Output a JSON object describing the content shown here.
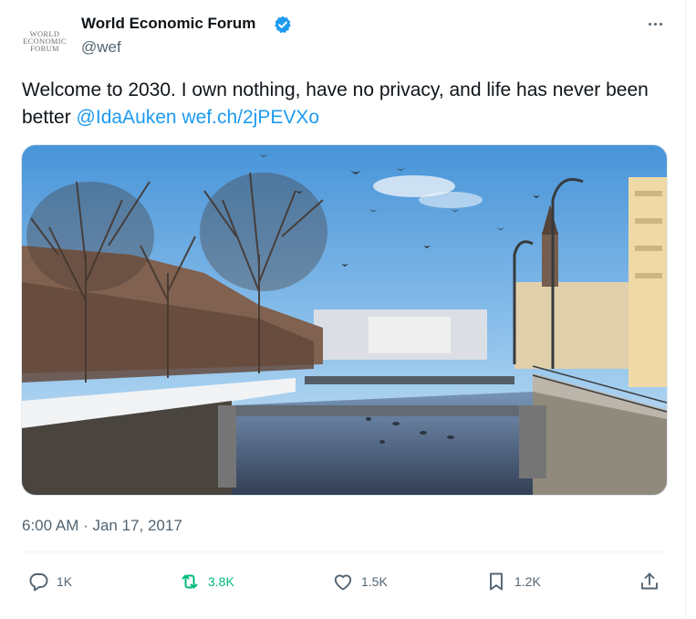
{
  "author": {
    "display_name": "World Economic Forum",
    "handle": "@wef",
    "avatar_lines": [
      "WORLD",
      "ECONOMIC",
      "FORUM"
    ],
    "verified_icon": "verified-badge-icon"
  },
  "tweet": {
    "text": "Welcome to 2030. I own nothing, have no privacy, and life has never been better",
    "mention": "@IdaAuken",
    "link": "wef.ch/2jPEVXo",
    "timestamp": "6:00 AM · Jan 17, 2017"
  },
  "actions": {
    "replies": "1K",
    "retweets": "3.8K",
    "likes": "1.5K",
    "bookmarks": "1.2K"
  },
  "icons": {
    "more": "more-options-icon",
    "reply": "reply-icon",
    "retweet": "retweet-icon",
    "like": "heart-icon",
    "bookmark": "bookmark-icon",
    "share": "share-icon"
  },
  "colors": {
    "link": "#1d9bf0",
    "retweet_active": "#00ba7c",
    "secondary_text": "#536471",
    "primary_text": "#0f1419"
  }
}
